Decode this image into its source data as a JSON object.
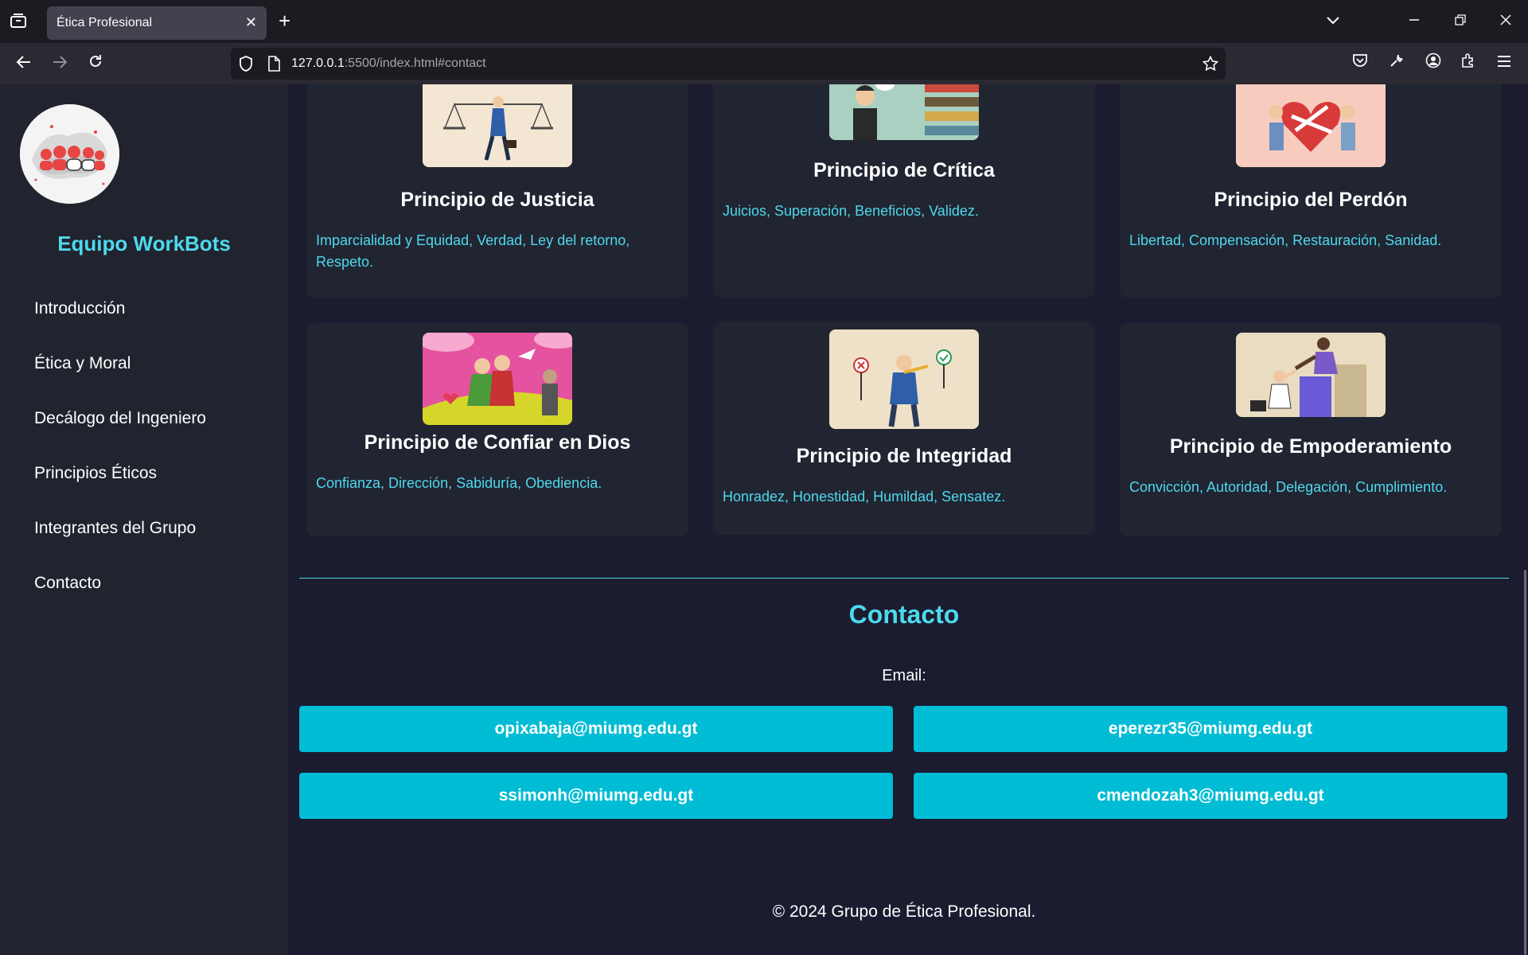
{
  "browser": {
    "tab_title": "Ética Profesional",
    "tab_close": "✕",
    "new_tab": "+",
    "url_host": "127.0.0.1",
    "url_rest": ":5500/index.html#contact"
  },
  "sidebar": {
    "team_name": "Equipo WorkBots",
    "items": [
      {
        "label": "Introducción"
      },
      {
        "label": "Ética y Moral"
      },
      {
        "label": "Decálogo del Ingeniero"
      },
      {
        "label": "Principios Éticos"
      },
      {
        "label": "Integrantes del Grupo"
      },
      {
        "label": "Contacto"
      }
    ]
  },
  "principles": [
    {
      "title": "Principio de Justicia",
      "text": "Imparcialidad y Equidad, Verdad, Ley del retorno, Respeto."
    },
    {
      "title": "Principio de Crítica",
      "text": "Juicios, Superación, Beneficios, Validez."
    },
    {
      "title": "Principio del Perdón",
      "text": "Libertad, Compensación, Restauración, Sanidad."
    },
    {
      "title": "Principio de Confiar en Dios",
      "text": "Confianza, Dirección, Sabiduría, Obediencia."
    },
    {
      "title": "Principio de Integridad",
      "text": "Honradez, Honestidad, Humildad, Sensatez."
    },
    {
      "title": "Principio de Empoderamiento",
      "text": "Convicción, Autoridad, Delegación, Cumplimiento."
    }
  ],
  "contact": {
    "title": "Contacto",
    "email_label": "Email:",
    "emails": [
      "opixabaja@miumg.edu.gt",
      "eperezr35@miumg.edu.gt",
      "ssimonh@miumg.edu.gt",
      "cmendozah3@miumg.edu.gt"
    ]
  },
  "footer": "© 2024 Grupo de Ética Profesional."
}
